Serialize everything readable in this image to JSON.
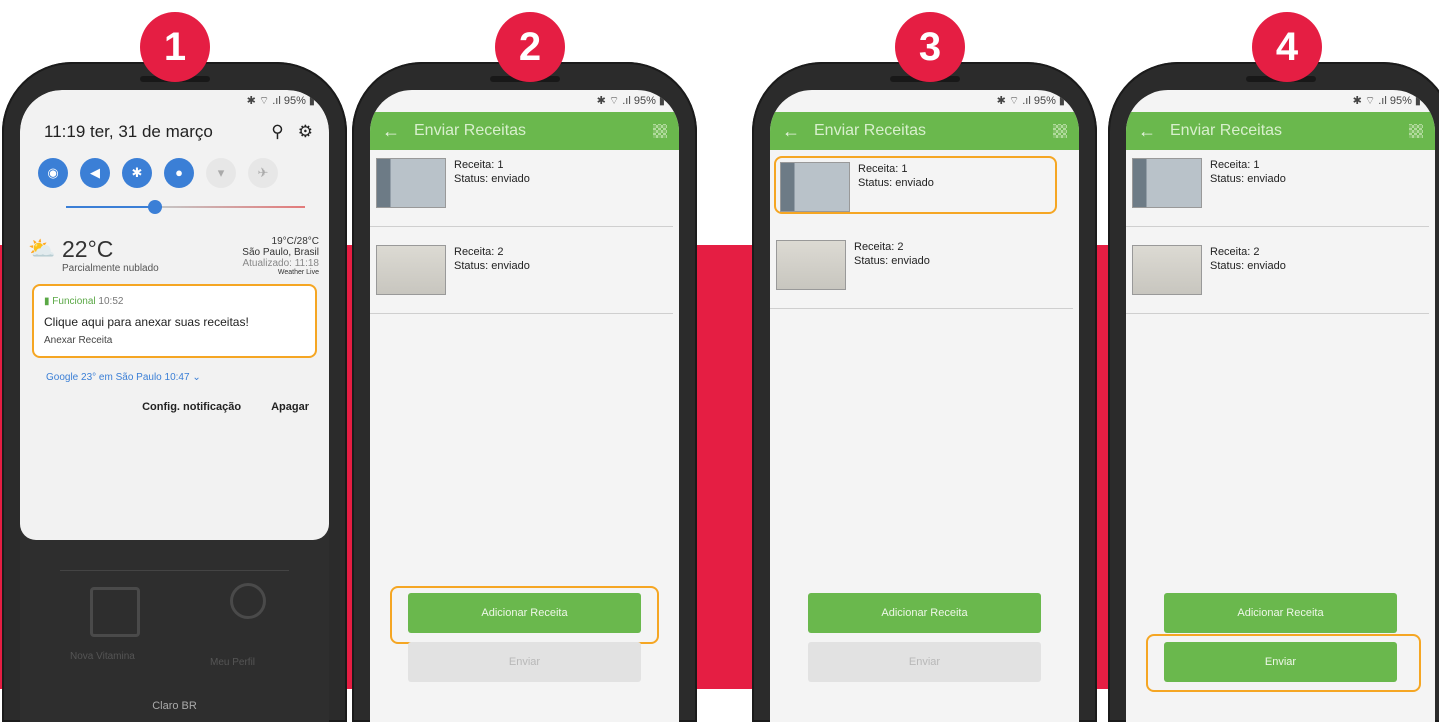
{
  "steps": [
    "1",
    "2",
    "3",
    "4"
  ],
  "status_bar": "✱ ⌔ .ıl 95% ▮",
  "panel1": {
    "clock": "11:19 ter, 31 de março",
    "weather_temp": "22°C",
    "weather_desc": "Parcialmente nublado",
    "weather_range": "19°C/28°C",
    "weather_city": "São Paulo, Brasil",
    "weather_updated": "Atualizado: 11:18",
    "weather_brand": "Weather Live",
    "notif_app": "Funcional",
    "notif_time": "10:52",
    "notif_title": "Clique aqui para anexar suas receitas!",
    "notif_action": "Anexar Receita",
    "google_line": "Google  23° em São Paulo  10:47",
    "config_label": "Config. notificação",
    "clear_label": "Apagar",
    "carrier": "Claro BR",
    "home_item_1": "Nova Vitamina",
    "home_item_2": "Meu Perfil"
  },
  "app": {
    "title": "Enviar Receitas",
    "items": [
      {
        "label": "Receita: 1",
        "status": "Status: enviado"
      },
      {
        "label": "Receita: 2",
        "status": "Status: enviado"
      }
    ],
    "add_button": "Adicionar Receita",
    "send_button": "Enviar"
  },
  "colors": {
    "accent_red": "#e51e43",
    "app_green": "#6ab84d",
    "highlight_orange": "#f5a623"
  }
}
